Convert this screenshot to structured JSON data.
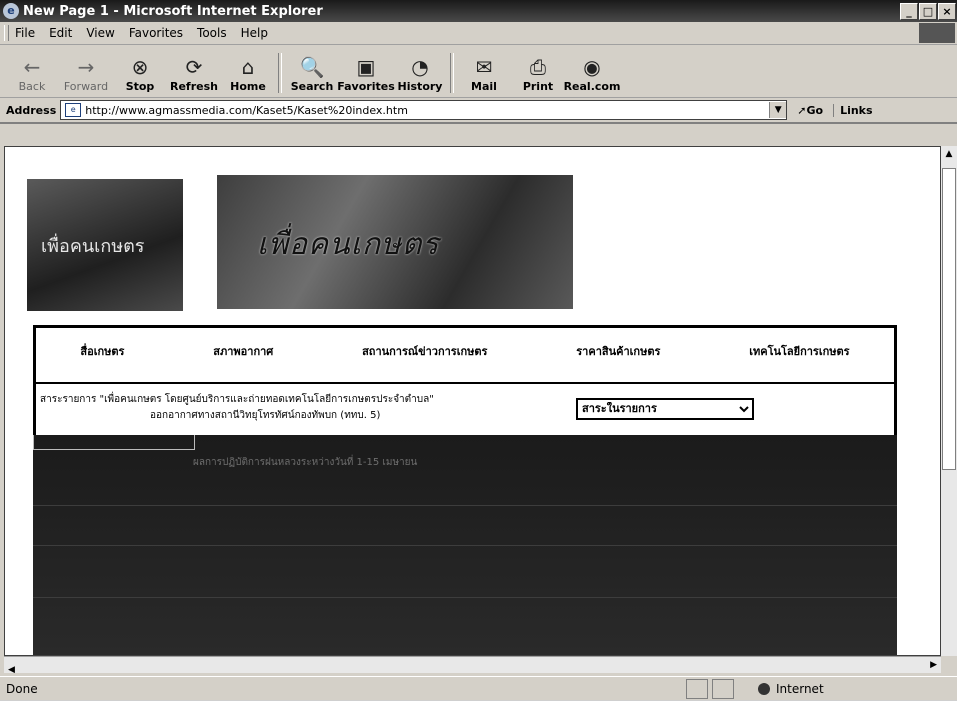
{
  "window": {
    "title": "New Page 1 - Microsoft Internet Explorer"
  },
  "menu": [
    "File",
    "Edit",
    "View",
    "Favorites",
    "Tools",
    "Help"
  ],
  "toolbar": {
    "back": "Back",
    "forward": "Forward",
    "stop": "Stop",
    "refresh": "Refresh",
    "home": "Home",
    "search": "Search",
    "favorites": "Favorites",
    "history": "History",
    "mail": "Mail",
    "print": "Print",
    "realcom": "Real.com"
  },
  "address": {
    "label": "Address",
    "url": "http://www.agmassmedia.com/Kaset5/Kaset%20index.htm",
    "go": "Go",
    "links": "Links"
  },
  "page": {
    "logo_text": "เพื่อคนเกษตร",
    "banner_text": "เพื่อคนเกษตร",
    "nav": [
      "สื่อเกษตร",
      "สภาพอากาศ",
      "สถานการณ์ข่าวการเกษตร",
      "ราคาสินค้าเกษตร",
      "เทคโนโลยีการเกษตร"
    ],
    "info_line1": "สาระรายการ \"เพื่อคนเกษตร โดยศูนย์บริการและถ่ายทอดเทคโนโลยีการเกษตรประจำตำบล\"",
    "info_line2": "ออกอากาศทางสถานีวิทยุโทรทัศน์กองทัพบก (ททบ. 5)",
    "select_value": "สาระในรายการ",
    "dark_line": "ผลการปฏิบัติการฝนหลวงระหว่างวันที่ 1-15 เมษายน"
  },
  "status": {
    "left": "Done",
    "zone": "Internet"
  }
}
